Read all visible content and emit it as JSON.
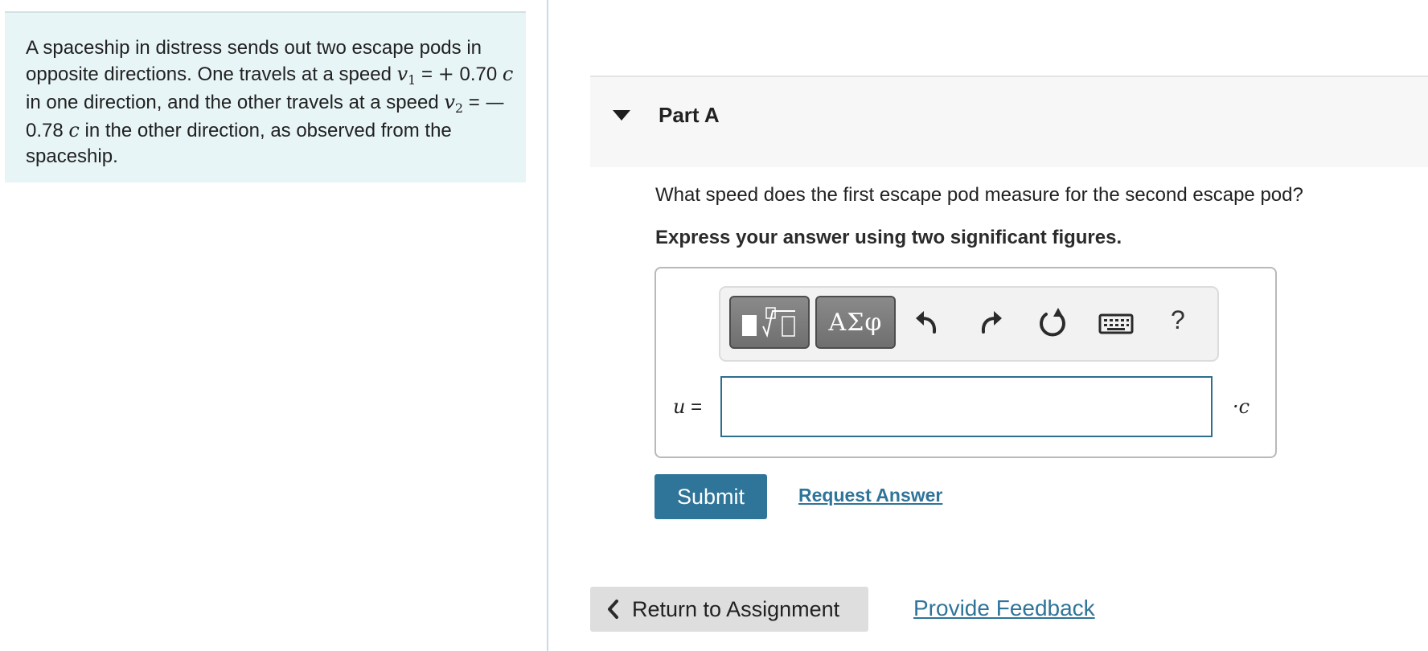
{
  "problem": {
    "text_part1": "A spaceship in distress sends out two escape pods in opposite directions. One travels at a speed",
    "v1_symbol": "v",
    "v1_subscript": "1",
    "v1_sign": "+",
    "v1_value": "0.70",
    "speed_of_light": "c",
    "text_part2": "in one direction, and the other travels at a speed",
    "v2_symbol": "v",
    "v2_subscript": "2",
    "v2_sign": "—",
    "v2_value": "0.78",
    "text_part3": "in the other direction, as observed from the spaceship."
  },
  "part": {
    "title": "Part A",
    "question": "What speed does the first escape pod measure for the second escape pod?",
    "instruction": "Express your answer using two significant figures."
  },
  "toolbar": {
    "symbols_label": "ΑΣφ",
    "help_label": "?",
    "icons": [
      "templates-icon",
      "undo-icon",
      "redo-icon",
      "reset-icon",
      "keyboard-icon",
      "help-icon"
    ]
  },
  "answer": {
    "variable": "u",
    "equals": "=",
    "value": "",
    "unit": "·c"
  },
  "actions": {
    "submit_label": "Submit",
    "request_answer_label": "Request Answer",
    "return_label": "Return to Assignment",
    "feedback_label": "Provide Feedback"
  },
  "colors": {
    "accent": "#2f7499",
    "problem_bg": "#e8f5f7",
    "header_bg": "#f7f7f7"
  }
}
